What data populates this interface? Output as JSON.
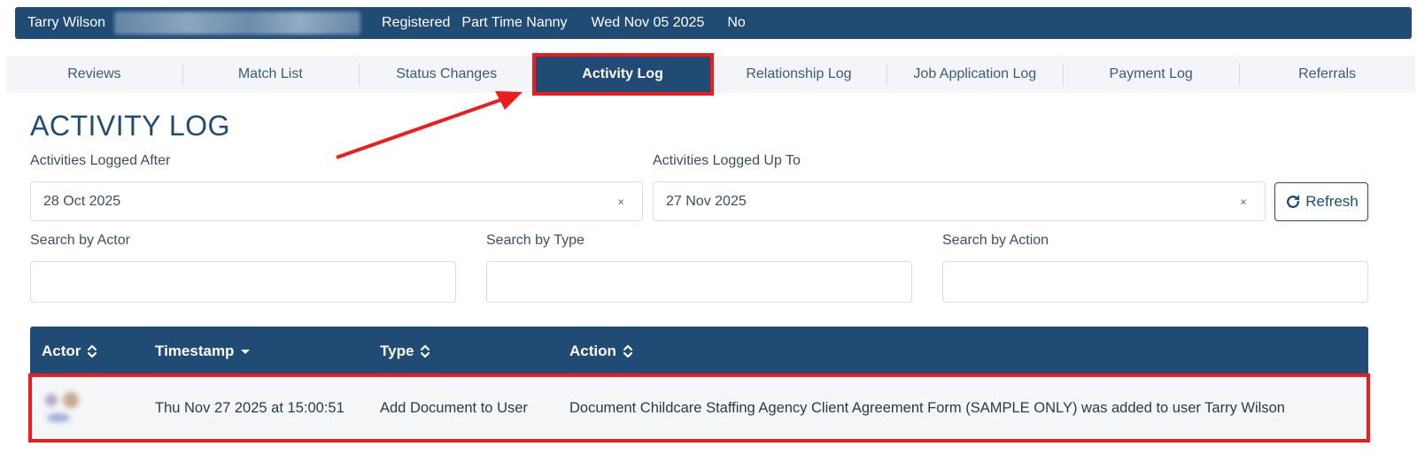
{
  "profile": {
    "name": "Tarry Wilson",
    "status": "Registered",
    "role": "Part Time Nanny",
    "date": "Wed Nov 05 2025",
    "flag": "No"
  },
  "tabs": [
    {
      "label": "Reviews",
      "active": false
    },
    {
      "label": "Match List",
      "active": false
    },
    {
      "label": "Status Changes",
      "active": false
    },
    {
      "label": "Activity Log",
      "active": true
    },
    {
      "label": "Relationship Log",
      "active": false
    },
    {
      "label": "Job Application Log",
      "active": false
    },
    {
      "label": "Payment Log",
      "active": false
    },
    {
      "label": "Referrals",
      "active": false
    }
  ],
  "page_title": "ACTIVITY LOG",
  "filters": {
    "after_label": "Activities Logged After",
    "after_value": "28 Oct 2025",
    "upto_label": "Activities Logged Up To",
    "upto_value": "27 Nov 2025",
    "clear_glyph": "×",
    "refresh_label": "Refresh",
    "actor_label": "Search by Actor",
    "actor_value": "",
    "type_label": "Search by Type",
    "type_value": "",
    "action_label": "Search by Action",
    "action_value": ""
  },
  "table": {
    "headers": {
      "actor": "Actor",
      "timestamp": "Timestamp",
      "type": "Type",
      "action": "Action"
    },
    "rows": [
      {
        "actor": "",
        "timestamp": "Thu Nov 27 2025 at 15:00:51",
        "type": "Add Document to User",
        "action": "Document Childcare Staffing Agency Client Agreement Form (SAMPLE ONLY) was added to user Tarry Wilson"
      }
    ]
  },
  "colors": {
    "primary": "#1f4b75",
    "highlight": "#ee1c1c",
    "tab_bg": "#f3f5f8"
  }
}
